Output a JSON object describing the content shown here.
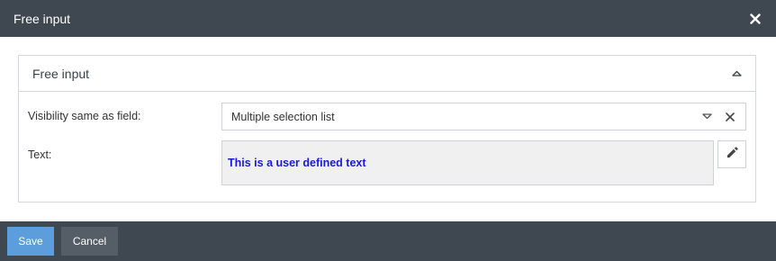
{
  "dialog": {
    "title": "Free input",
    "close_icon": "close-icon"
  },
  "panel": {
    "title": "Free input",
    "collapse_icon": "caret-up-icon"
  },
  "fields": {
    "visibility": {
      "label": "Visibility same as field:",
      "value": "Multiple selection list",
      "dropdown_icon": "caret-down-icon",
      "clear_icon": "clear-icon"
    },
    "text": {
      "label": "Text:",
      "value": "This is a user defined text",
      "value_color": "#1a1ad6",
      "edit_icon": "pencil-icon"
    }
  },
  "footer": {
    "save_label": "Save",
    "cancel_label": "Cancel"
  },
  "colors": {
    "titlebar": "#3f4851",
    "footer": "#3f4851",
    "save_button": "#5c9ddc",
    "cancel_button": "#555e67"
  }
}
